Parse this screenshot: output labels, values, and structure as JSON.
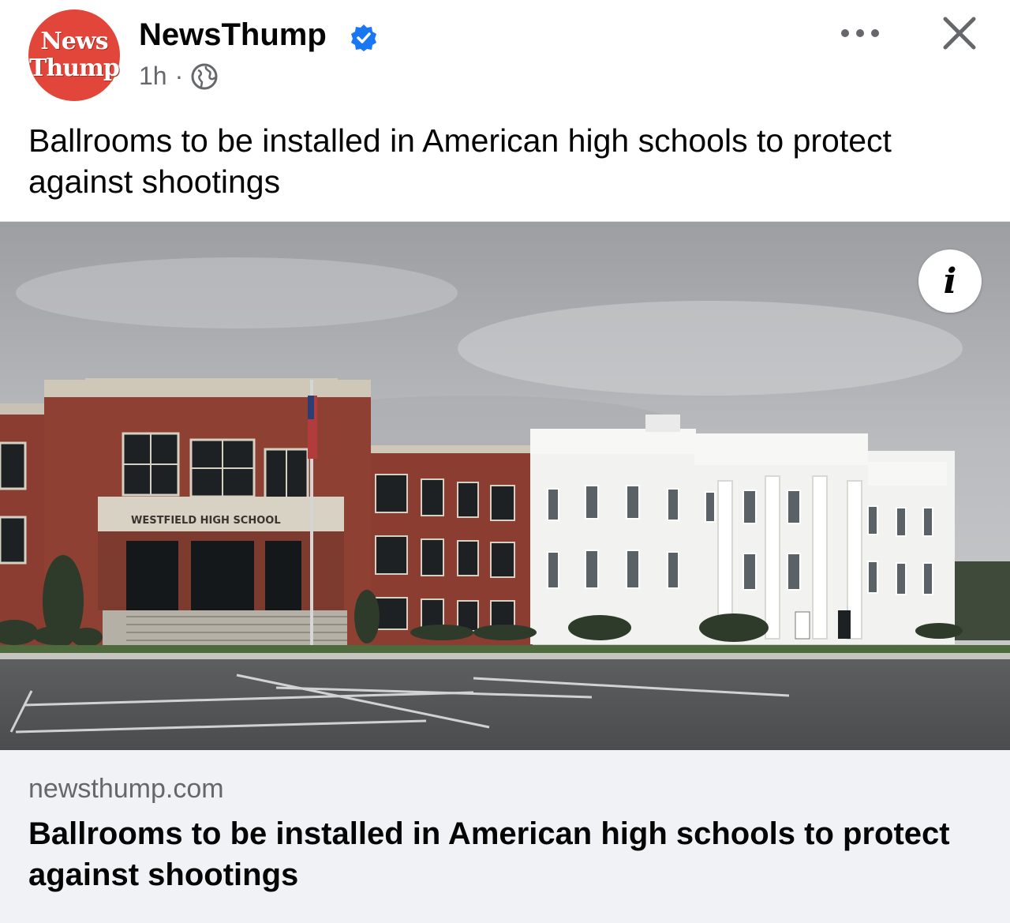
{
  "post": {
    "page_name": "NewsThump",
    "avatar_line1": "News",
    "avatar_line2": "Thump",
    "time": "1h",
    "separator": "·",
    "audience_icon": "globe-icon",
    "verified_icon": "verified-badge-icon",
    "text": "Ballrooms to be installed in American high schools to protect against shootings"
  },
  "image": {
    "sign_text": "WESTFIELD HIGH SCHOOL",
    "info_label": "i"
  },
  "link_card": {
    "domain": "newsthump.com",
    "title": "Ballrooms to be installed in American high schools to protect against shootings"
  },
  "colors": {
    "avatar_red": "#e2463a",
    "verified_blue": "#1877f2",
    "meta_gray": "#65676b",
    "card_bg": "#f0f2f5"
  }
}
